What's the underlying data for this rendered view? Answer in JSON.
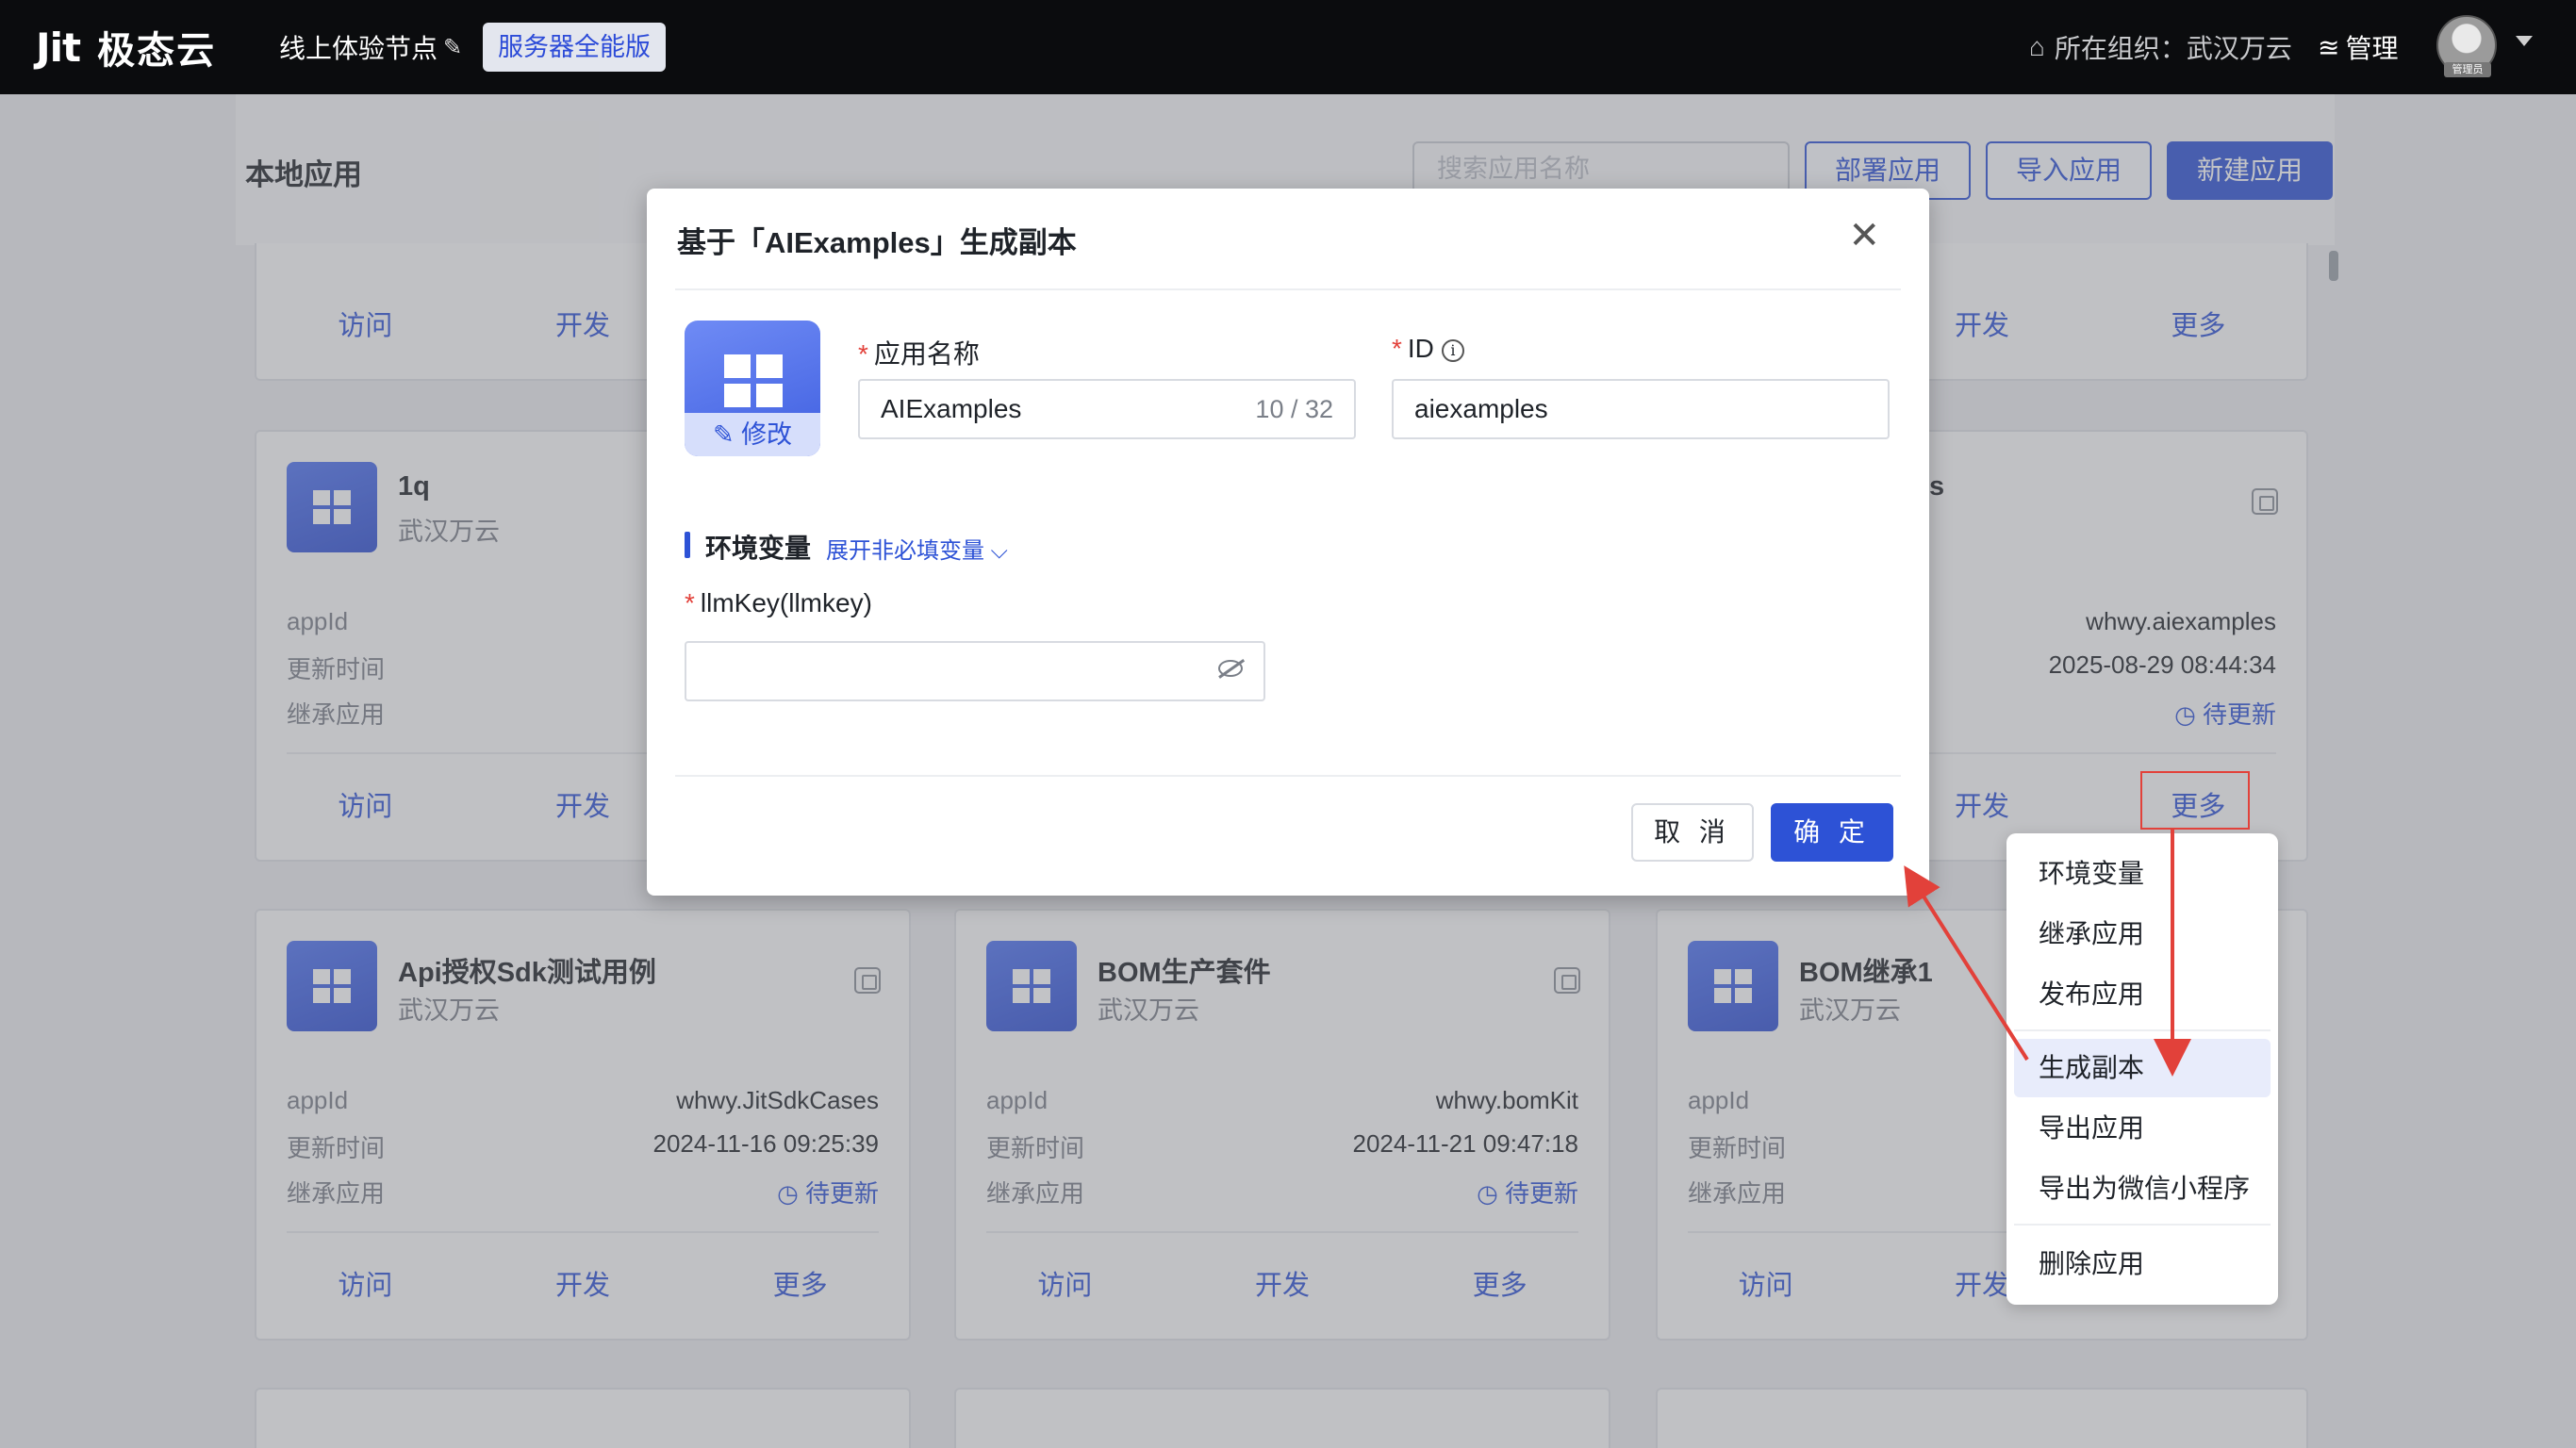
{
  "topbar": {
    "logo_mark": "Jit",
    "logo_text": "极态云",
    "node_name": "线上体验节点",
    "edition": "服务器全能版",
    "org_label": "所在组织：武汉万云",
    "manage_label": "管理",
    "avatar_tag": "管理员"
  },
  "page": {
    "title": "本地应用",
    "search_placeholder": "搜索应用名称",
    "deploy_button": "部署应用",
    "import_button": "导入应用",
    "new_button": "新建应用"
  },
  "card_labels": {
    "appid": "appId",
    "updated": "更新时间",
    "inherit": "继承应用",
    "visit": "访问",
    "develop": "开发",
    "more": "更多"
  },
  "cards": [
    {
      "title": "1q",
      "org": "武汉万云"
    },
    {
      "title": "",
      "org": "",
      "appid": "whwy.aiexamples",
      "updated": "2025-08-29 08:44:34",
      "inherit": "待更新",
      "partial_title": "s"
    },
    {
      "title": "Api授权Sdk测试用例",
      "org": "武汉万云",
      "appid": "whwy.JitSdkCases",
      "updated": "2024-11-16 09:25:39",
      "inherit": "待更新"
    },
    {
      "title": "BOM生产套件",
      "org": "武汉万云",
      "appid": "whwy.bomKit",
      "updated": "2024-11-21 09:47:18",
      "inherit": "待更新"
    },
    {
      "title": "BOM继承1",
      "org": "武汉万云"
    }
  ],
  "modal": {
    "title": "基于「AIExamples」生成副本",
    "icon_edit": "修改",
    "name_label": "应用名称",
    "name_value": "AIExamples",
    "name_counter": "10 / 32",
    "id_label": "ID",
    "id_value": "aiexamples",
    "section_title": "环境变量",
    "section_link": "展开非必填变量",
    "env_label": "llmKey(llmkey)",
    "env_value": "",
    "cancel": "取 消",
    "ok": "确 定"
  },
  "menu": {
    "items": [
      "环境变量",
      "继承应用",
      "发布应用",
      "生成副本",
      "导出应用",
      "导出为微信小程序",
      "删除应用"
    ],
    "active": "生成副本"
  },
  "colors": {
    "accent": "#2d52d6",
    "annotation": "#e2413a",
    "topbar": "#0b0c0e"
  }
}
